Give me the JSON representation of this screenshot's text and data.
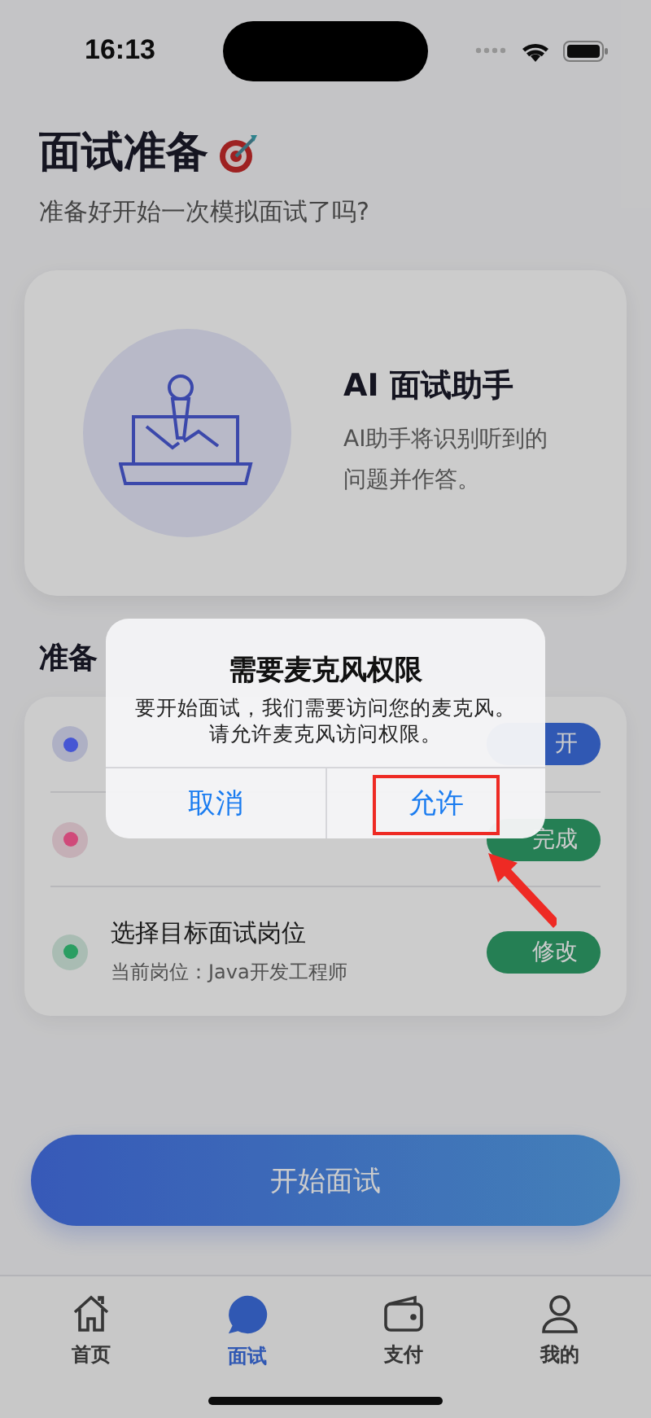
{
  "status_bar": {
    "time": "16:13"
  },
  "header": {
    "title": "面试准备",
    "subtitle": "准备好开始一次模拟面试了吗?"
  },
  "assistant_card": {
    "title": "AI 面试助手",
    "description": "AI助手将识别听到的问题并作答。"
  },
  "section": {
    "title": "准备"
  },
  "checklist": [
    {
      "color": "#4656d4",
      "button": {
        "label": "开",
        "kind": "primary"
      }
    },
    {
      "color": "#d04a7a",
      "button": {
        "label": "完成",
        "kind": "success"
      }
    },
    {
      "color": "#2a9e62",
      "title": "选择目标面试岗位",
      "detail": "当前岗位：Java开发工程师",
      "button": {
        "label": "修改",
        "kind": "success"
      }
    }
  ],
  "start_button": {
    "label": "开始面试"
  },
  "tabs": [
    {
      "label": "首页",
      "selected": false
    },
    {
      "label": "面试",
      "selected": true
    },
    {
      "label": "支付",
      "selected": false
    },
    {
      "label": "我的",
      "selected": false
    }
  ],
  "dialog": {
    "title": "需要麦克风权限",
    "message": [
      "要开始面试，我们需要访问您的麦克风。",
      "请允许麦克风访问权限。"
    ],
    "buttons": [
      {
        "label": "取消",
        "highlighted": false
      },
      {
        "label": "允许",
        "highlighted": true
      }
    ]
  }
}
